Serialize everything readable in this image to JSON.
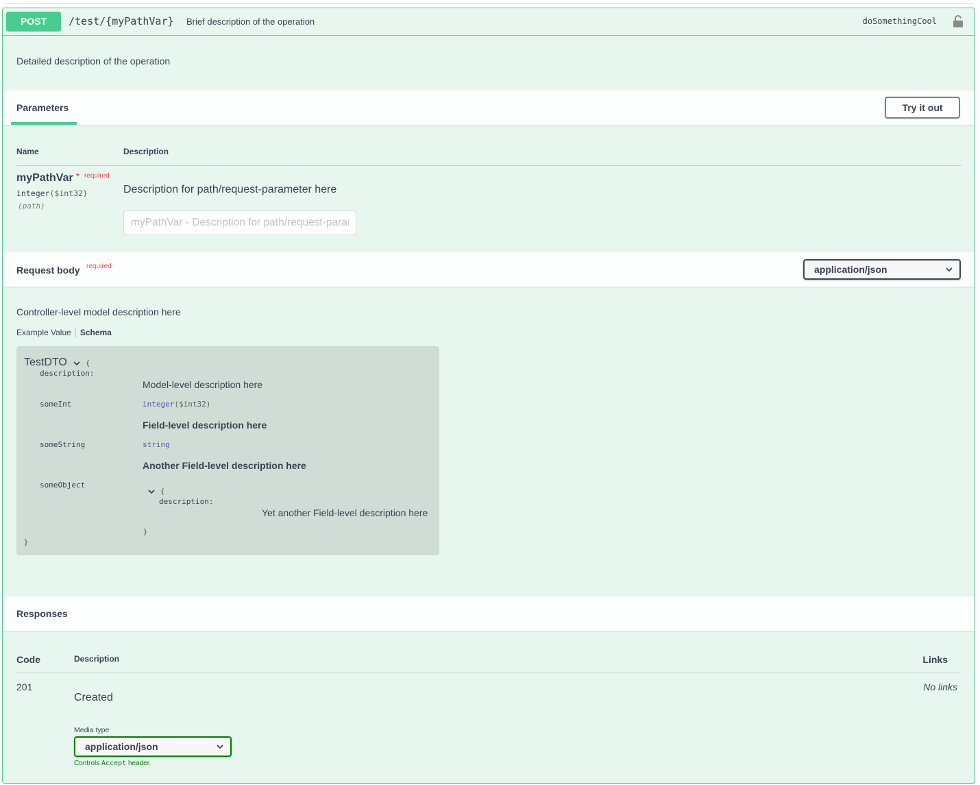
{
  "operation": {
    "method": "POST",
    "path": "/test/{myPathVar}",
    "summary": "Brief description of the operation",
    "operation_id": "doSomethingCool",
    "description": "Detailed description of the operation"
  },
  "parameters": {
    "tab_label": "Parameters",
    "try_out_label": "Try it out",
    "col_name": "Name",
    "col_description": "Description",
    "items": [
      {
        "name": "myPathVar",
        "required_star": "*",
        "required_label": "required",
        "type": "integer",
        "format": "($int32)",
        "location": "(path)",
        "description": "Description for path/request-parameter here",
        "input_placeholder": "myPathVar - Description for path/request-parameter here"
      }
    ]
  },
  "request_body": {
    "title": "Request body",
    "required_label": "required",
    "content_type": "application/json",
    "description": "Controller-level model description here",
    "tab_example": "Example Value",
    "tab_schema": "Schema",
    "model": {
      "name": "TestDTO",
      "open_brace": "{",
      "close_brace": "}",
      "description_key": "description:",
      "description_value": "Model-level description here",
      "fields": [
        {
          "name": "someInt",
          "type": "integer",
          "format": "($int32)",
          "description": "Field-level description here"
        },
        {
          "name": "someString",
          "type": "string",
          "description": "Another Field-level description here"
        },
        {
          "name": "someObject",
          "open_brace": "{",
          "description_key": "description:",
          "description_value": "Yet another Field-level description here",
          "close_brace": "}"
        }
      ]
    }
  },
  "responses": {
    "title": "Responses",
    "col_code": "Code",
    "col_description": "Description",
    "col_links": "Links",
    "items": [
      {
        "code": "201",
        "description": "Created",
        "links": "No links",
        "media_type_label": "Media type",
        "media_type": "application/json",
        "controls_prefix": "Controls",
        "controls_code": "Accept",
        "controls_suffix": "header."
      }
    ]
  },
  "colors": {
    "post_green": "#49cc90",
    "block_bg": "#e8f6f0",
    "required_red": "#ff0000",
    "accept_green": "#008000"
  }
}
